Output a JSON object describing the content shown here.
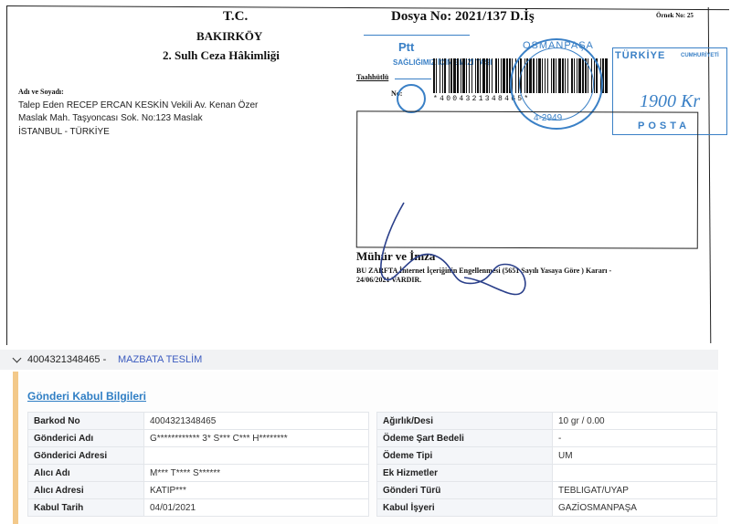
{
  "envelope": {
    "tc": "T.C.",
    "court_city": "BAKIRKÖY",
    "court_name": "2. Sulh Ceza Hâkimliği",
    "dosya": "Dosya No:  2021/137 D.İş",
    "ornek": "Örnek No: 25",
    "address_label": "Adı ve Soyadı:",
    "address_lines": [
      "Talep Eden RECEP ERCAN KESKİN Vekili Av. Kenan Özer",
      "Maslak Mah. Taşyoncası Sok. No:123 Maslak",
      "İSTANBUL - TÜRKİYE"
    ],
    "ptt_logo": "Ptt",
    "ptt_slogan": "SAĞLIĞIMIZ İÇİN EMİZİ TAŞI",
    "taahhutlu": "Taahhütlü",
    "no_label": "No:",
    "barcode_text": "*4004321348465*",
    "postmark_top": "OSMANPAŞA",
    "postmark_bottom": "4-2949",
    "postage_country": "TÜRKİYE",
    "postage_comm": "CUMHURİYETİ",
    "postage_amount": "1900 Kr",
    "postage_posta": "POSTA",
    "seal_label": "Mühür ve İmza",
    "notice_line1": "BU ZARFTA İnternet İçeriğinin Engellenmesi (5651 Sayılı Yasaya Göre ) Kararı -",
    "notice_line2": "24/06/2021 VARDIR.",
    "colors": {
      "stamp_blue": "#3a80c6",
      "ink": "#222222"
    }
  },
  "tracking": {
    "barcode": "4004321348465  -",
    "status": "MAZBATA TESLİM",
    "section_title": "Gönderi Kabul Bilgileri",
    "left_rows": [
      {
        "key": "Barkod No",
        "value": "4004321348465"
      },
      {
        "key": "Gönderici Adı",
        "value": "G************ 3* S*** C*** H********"
      },
      {
        "key": "Gönderici Adresi",
        "value": ""
      },
      {
        "key": "Alıcı Adı",
        "value": "M*** T**** S******"
      },
      {
        "key": "Alıcı Adresi",
        "value": "KATIP***"
      },
      {
        "key": "Kabul Tarih",
        "value": "04/01/2021"
      }
    ],
    "right_rows": [
      {
        "key": "Ağırlık/Desi",
        "value": "10 gr / 0.00"
      },
      {
        "key": "Ödeme Şart Bedeli",
        "value": "-"
      },
      {
        "key": "Ödeme Tipi",
        "value": "UM"
      },
      {
        "key": "Ek Hizmetler",
        "value": ""
      },
      {
        "key": "Gönderi Türü",
        "value": "TEBLIGAT/UYAP"
      },
      {
        "key": "Kabul İşyeri",
        "value": "GAZİOSMANPAŞA"
      }
    ],
    "colors": {
      "accent": "#f3c98a",
      "link": "#2f7ec4",
      "status": "#3b5bbf"
    }
  }
}
